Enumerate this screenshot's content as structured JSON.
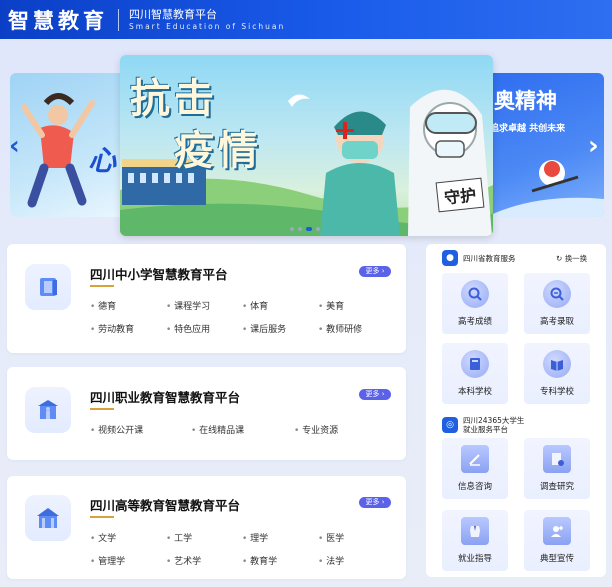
{
  "header": {
    "logo": "智慧教育",
    "platform_cn": "四川智慧教育平台",
    "platform_en": "Smart Education of Sichuan"
  },
  "carousel": {
    "main_title_line1": "抗击",
    "main_title_line2": "疫情",
    "main_badge": "守护",
    "left_text": "心",
    "right_text": "奥精神",
    "right_sub": "追求卓越 共创未来",
    "prev": "‹",
    "next": "›"
  },
  "cards": [
    {
      "title": "四川中小学智慧教育平台",
      "more": "更多 ›",
      "links": [
        "德育",
        "课程学习",
        "体育",
        "美育",
        "劳动教育",
        "特色应用",
        "课后服务",
        "教师研修"
      ]
    },
    {
      "title": "四川职业教育智慧教育平台",
      "more": "更多 ›",
      "links": [
        "视频公开课",
        "在线精品课",
        "专业资源"
      ]
    },
    {
      "title": "四川高等教育智慧教育平台",
      "more": "更多 ›",
      "links": [
        "文学",
        "工学",
        "理学",
        "医学",
        "管理学",
        "艺术学",
        "教育学",
        "法学"
      ]
    }
  ],
  "right_panel": {
    "service1_name": "四川省教育服务",
    "switch": "换一换",
    "service1_tiles": [
      "高考成绩",
      "高考录取",
      "本科学校",
      "专科学校"
    ],
    "service2_name_line1": "四川24365大学生",
    "service2_name_line2": "就业服务平台",
    "service2_tiles": [
      "信息咨询",
      "调查研究",
      "就业指导",
      "典型宣传"
    ]
  },
  "colors": {
    "header": "#1a5bea",
    "more_button": "#5b62e8",
    "accent_underline": "#d8a13a"
  }
}
